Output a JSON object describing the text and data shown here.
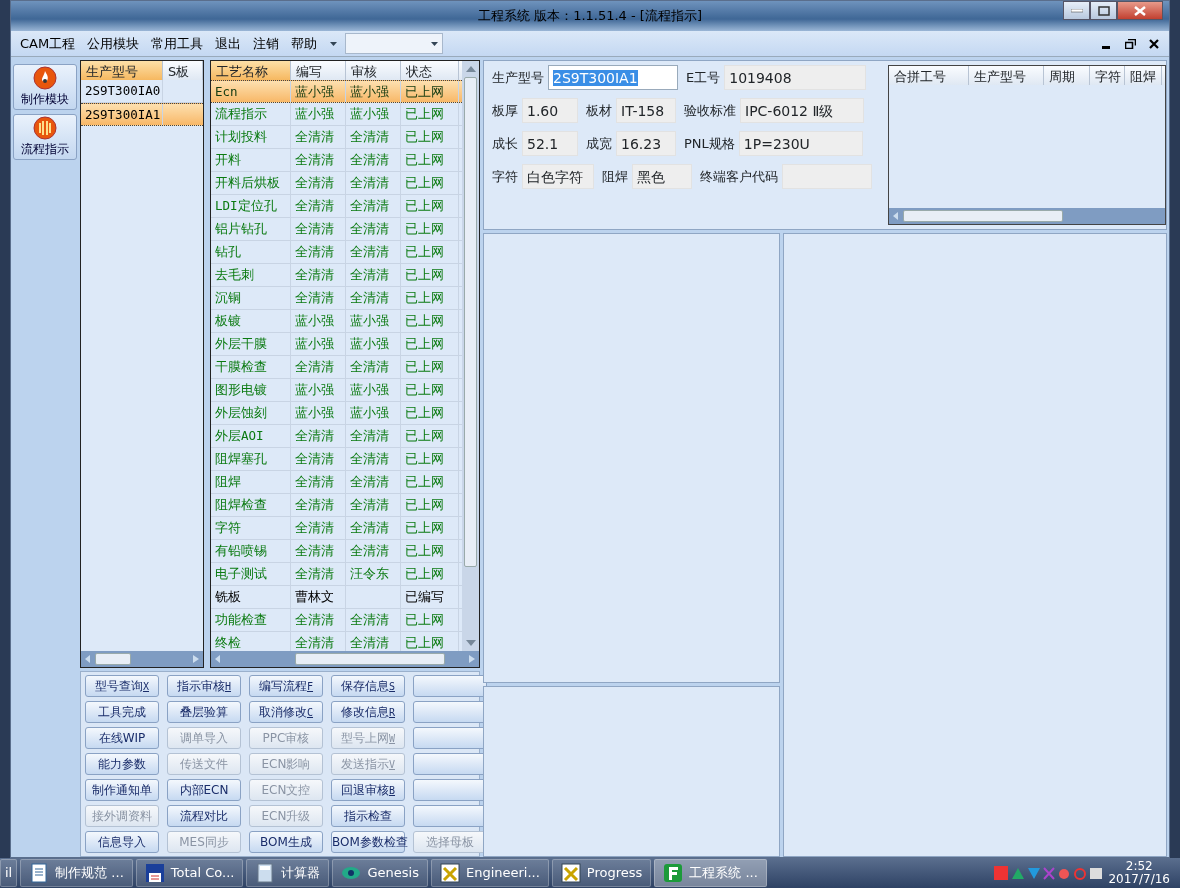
{
  "window": {
    "title": "工程系统   版本：1.1.51.4 - [流程指示]"
  },
  "menu": [
    "CAM工程",
    "公用模块",
    "常用工具",
    "退出",
    "注销",
    "帮助"
  ],
  "sidebar": [
    {
      "label": "制作模块",
      "kind": "fire"
    },
    {
      "label": "流程指示",
      "kind": "bars"
    }
  ],
  "models": {
    "columns": [
      "生产型号",
      "S板"
    ],
    "rows": [
      {
        "cells": [
          "2S9T300IA0",
          ""
        ],
        "selected": false
      },
      {
        "cells": [
          "2S9T300IA1"
        ],
        "selected": true
      }
    ]
  },
  "process": {
    "columns": [
      "工艺名称",
      "编写",
      "审核",
      "状态"
    ],
    "rows": [
      {
        "cells": [
          "Ecn",
          "蓝小强",
          "蓝小强",
          "已上网"
        ],
        "selected": true,
        "online": true
      },
      {
        "cells": [
          "流程指示",
          "蓝小强",
          "蓝小强",
          "已上网"
        ],
        "selected": false,
        "online": true
      },
      {
        "cells": [
          "计划投料",
          "全清清",
          "全清清",
          "已上网"
        ],
        "selected": false,
        "online": true
      },
      {
        "cells": [
          "开料",
          "全清清",
          "全清清",
          "已上网"
        ],
        "selected": false,
        "online": true
      },
      {
        "cells": [
          "开料后烘板",
          "全清清",
          "全清清",
          "已上网"
        ],
        "selected": false,
        "online": true
      },
      {
        "cells": [
          "LDI定位孔",
          "全清清",
          "全清清",
          "已上网"
        ],
        "selected": false,
        "online": true
      },
      {
        "cells": [
          "铝片钻孔",
          "全清清",
          "全清清",
          "已上网"
        ],
        "selected": false,
        "online": true
      },
      {
        "cells": [
          "钻孔",
          "全清清",
          "全清清",
          "已上网"
        ],
        "selected": false,
        "online": true
      },
      {
        "cells": [
          "去毛刺",
          "全清清",
          "全清清",
          "已上网"
        ],
        "selected": false,
        "online": true
      },
      {
        "cells": [
          "沉铜",
          "全清清",
          "全清清",
          "已上网"
        ],
        "selected": false,
        "online": true
      },
      {
        "cells": [
          "板镀",
          "蓝小强",
          "蓝小强",
          "已上网"
        ],
        "selected": false,
        "online": true
      },
      {
        "cells": [
          "外层干膜",
          "蓝小强",
          "蓝小强",
          "已上网"
        ],
        "selected": false,
        "online": true
      },
      {
        "cells": [
          "干膜检查",
          "全清清",
          "全清清",
          "已上网"
        ],
        "selected": false,
        "online": true
      },
      {
        "cells": [
          "图形电镀",
          "蓝小强",
          "蓝小强",
          "已上网"
        ],
        "selected": false,
        "online": true
      },
      {
        "cells": [
          "外层蚀刻",
          "蓝小强",
          "蓝小强",
          "已上网"
        ],
        "selected": false,
        "online": true
      },
      {
        "cells": [
          "外层AOI",
          "全清清",
          "全清清",
          "已上网"
        ],
        "selected": false,
        "online": true
      },
      {
        "cells": [
          "阻焊塞孔",
          "全清清",
          "全清清",
          "已上网"
        ],
        "selected": false,
        "online": true
      },
      {
        "cells": [
          "阻焊",
          "全清清",
          "全清清",
          "已上网"
        ],
        "selected": false,
        "online": true
      },
      {
        "cells": [
          "阻焊检查",
          "全清清",
          "全清清",
          "已上网"
        ],
        "selected": false,
        "online": true
      },
      {
        "cells": [
          "字符",
          "全清清",
          "全清清",
          "已上网"
        ],
        "selected": false,
        "online": true
      },
      {
        "cells": [
          "有铅喷锡",
          "全清清",
          "全清清",
          "已上网"
        ],
        "selected": false,
        "online": true
      },
      {
        "cells": [
          "电子测试",
          "全清清",
          "汪令东",
          "已上网"
        ],
        "selected": false,
        "online": true
      },
      {
        "cells": [
          "铣板",
          "曹林文",
          "",
          "已编写"
        ],
        "selected": false,
        "online": false
      },
      {
        "cells": [
          "功能检查",
          "全清清",
          "全清清",
          "已上网"
        ],
        "selected": false,
        "online": true
      },
      {
        "cells": [
          "终检",
          "全清清",
          "全清清",
          "已上网"
        ],
        "selected": false,
        "online": true
      }
    ]
  },
  "buttons": [
    [
      {
        "label": "型号查询",
        "key": "X",
        "disabled": false
      },
      {
        "label": "指示审核",
        "key": "H",
        "disabled": false
      },
      {
        "label": "编写流程",
        "key": "F",
        "disabled": false
      },
      {
        "label": "保存信息",
        "key": "S",
        "disabled": false
      },
      {
        "disabled": false
      }
    ],
    [
      {
        "label": "工具完成",
        "disabled": false
      },
      {
        "label": "叠层验算",
        "disabled": false
      },
      {
        "label": "取消修改",
        "key": "C",
        "disabled": false
      },
      {
        "label": "修改信息",
        "key": "R",
        "disabled": false
      },
      {
        "disabled": false
      }
    ],
    [
      {
        "label": "在线WIP",
        "disabled": false
      },
      {
        "label": "调单导入",
        "disabled": true
      },
      {
        "label": "PPC审核",
        "disabled": true
      },
      {
        "label": "型号上网",
        "key": "W",
        "disabled": true
      },
      {
        "disabled": false
      }
    ],
    [
      {
        "label": "能力参数",
        "disabled": false
      },
      {
        "label": "传送文件",
        "disabled": true
      },
      {
        "label": "ECN影响",
        "disabled": true
      },
      {
        "label": "发送指示",
        "key": "V",
        "disabled": true
      },
      {
        "disabled": false
      }
    ],
    [
      {
        "label": "制作通知单",
        "disabled": false
      },
      {
        "label": "内部ECN",
        "disabled": false
      },
      {
        "label": "ECN文控",
        "disabled": true
      },
      {
        "label": "回退审核",
        "key": "B",
        "disabled": false
      },
      {
        "disabled": false
      }
    ],
    [
      {
        "label": "接外调资料",
        "disabled": true
      },
      {
        "label": "流程对比",
        "disabled": false
      },
      {
        "label": "ECN升级",
        "disabled": true
      },
      {
        "label": "指示检查",
        "disabled": false
      },
      {
        "disabled": false
      }
    ],
    [
      {
        "label": "信息导入",
        "disabled": false
      },
      {
        "label": "MES同步",
        "disabled": true
      },
      {
        "label": "BOM生成",
        "disabled": false
      },
      {
        "label": "BOM参数检查",
        "disabled": false
      },
      {
        "label": "选择母板",
        "disabled": true
      }
    ]
  ],
  "info": {
    "fields": [
      [
        {
          "label": "生产型号",
          "value": "2S9T300IA1",
          "highlighted": true
        },
        {
          "label": "E工号",
          "value": "1019408",
          "highlighted": false
        }
      ],
      [
        {
          "label": "板厚",
          "value": "1.60",
          "highlighted": false
        },
        {
          "label": "板材",
          "value": "IT-158",
          "highlighted": false
        },
        {
          "label": "验收标准",
          "value": "IPC-6012 Ⅱ级",
          "highlighted": false
        }
      ],
      [
        {
          "label": "成长",
          "value": "52.1",
          "highlighted": false
        },
        {
          "label": "成宽",
          "value": "16.23",
          "highlighted": false
        },
        {
          "label": "PNL规格",
          "value": "1P=230U",
          "highlighted": false
        }
      ],
      [
        {
          "label": "字符",
          "value": "白色字符",
          "highlighted": false
        },
        {
          "label": "阻焊",
          "value": "黑色",
          "highlighted": false
        },
        {
          "label": "终端客户代码",
          "highlighted": false
        }
      ]
    ],
    "merge_table": {
      "columns": [
        "合拼工号",
        "生产型号",
        "周期",
        "字符",
        "阻焊"
      ]
    }
  },
  "taskbar": {
    "items": [
      {
        "label": "il",
        "active": false,
        "kind": "none"
      },
      {
        "label": "制作规范 ...",
        "active": false,
        "kind": "doc"
      },
      {
        "label": "Total Co...",
        "active": false,
        "kind": "disk"
      },
      {
        "label": "计算器",
        "active": false,
        "kind": "calc"
      },
      {
        "label": "Genesis",
        "active": false,
        "kind": "eye"
      },
      {
        "label": "Engineeri...",
        "active": false,
        "kind": "x"
      },
      {
        "label": "Progress",
        "active": false,
        "kind": "x"
      },
      {
        "label": "工程系统 ...",
        "active": true,
        "kind": "f"
      }
    ],
    "time": "2:52",
    "date": "2017/7/16"
  }
}
